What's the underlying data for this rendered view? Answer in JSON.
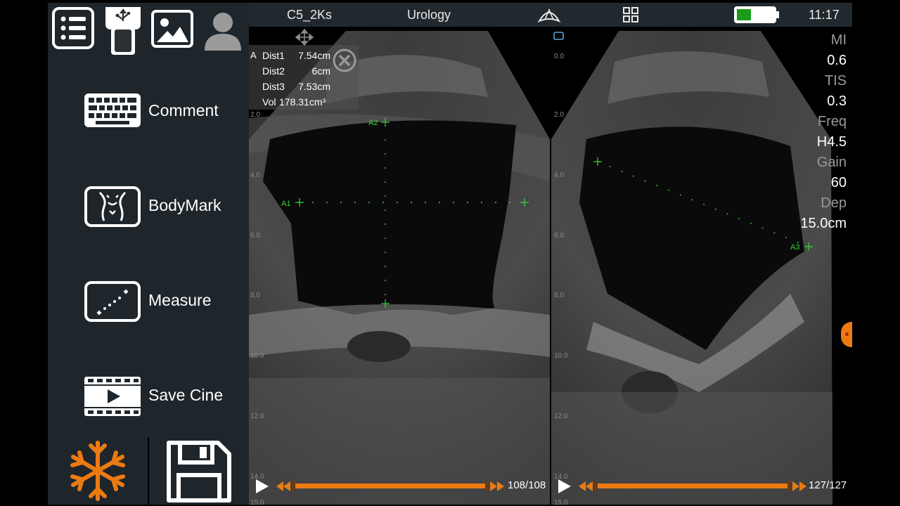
{
  "status": {
    "probe": "C5_2Ks",
    "preset": "Urology",
    "time": "11:17",
    "battery_color": "#1a9c1a"
  },
  "toolbar": {
    "icons": [
      "list-icon",
      "usb-probe-icon",
      "image-gallery-icon",
      "patient-avatar-icon"
    ]
  },
  "menu": {
    "items": [
      {
        "label": "Comment",
        "icon": "keyboard-icon"
      },
      {
        "label": "BodyMark",
        "icon": "bodymark-icon"
      },
      {
        "label": "Measure",
        "icon": "measure-icon"
      },
      {
        "label": "Save Cine",
        "icon": "film-icon"
      }
    ]
  },
  "bottom": {
    "freeze_icon": "snowflake-icon",
    "save_icon": "floppy-disk-icon",
    "accent": "#ec7a12"
  },
  "measurements": {
    "tag": "A",
    "rows": [
      {
        "label": "Dist1",
        "value": "7.54cm"
      },
      {
        "label": "Dist2",
        "value": "6cm"
      },
      {
        "label": "Dist3",
        "value": "7.53cm"
      },
      {
        "label": "Vol",
        "value": "178.31cm³"
      }
    ]
  },
  "calipers": {
    "a1": "A1",
    "a2": "A2",
    "a3": "A3",
    "color": "#3ad13a"
  },
  "params": [
    {
      "key": "MI",
      "value": "0.6"
    },
    {
      "key": "TIS",
      "value": "0.3"
    },
    {
      "key": "Freq",
      "value": "H4.5"
    },
    {
      "key": "Gain",
      "value": "60"
    },
    {
      "key": "Dep",
      "value": "15.0cm"
    }
  ],
  "depth_scale": {
    "left": [
      "2.0",
      "4.0",
      "6.0",
      "8.0",
      "10.0",
      "12.0",
      "14.0",
      "15.0"
    ],
    "right": [
      "0.0",
      "2.0",
      "4.0",
      "6.0",
      "8.0",
      "10.0",
      "12.0",
      "14.0",
      "15.0"
    ]
  },
  "cine": {
    "left_count": "108/108",
    "right_count": "127/127"
  }
}
